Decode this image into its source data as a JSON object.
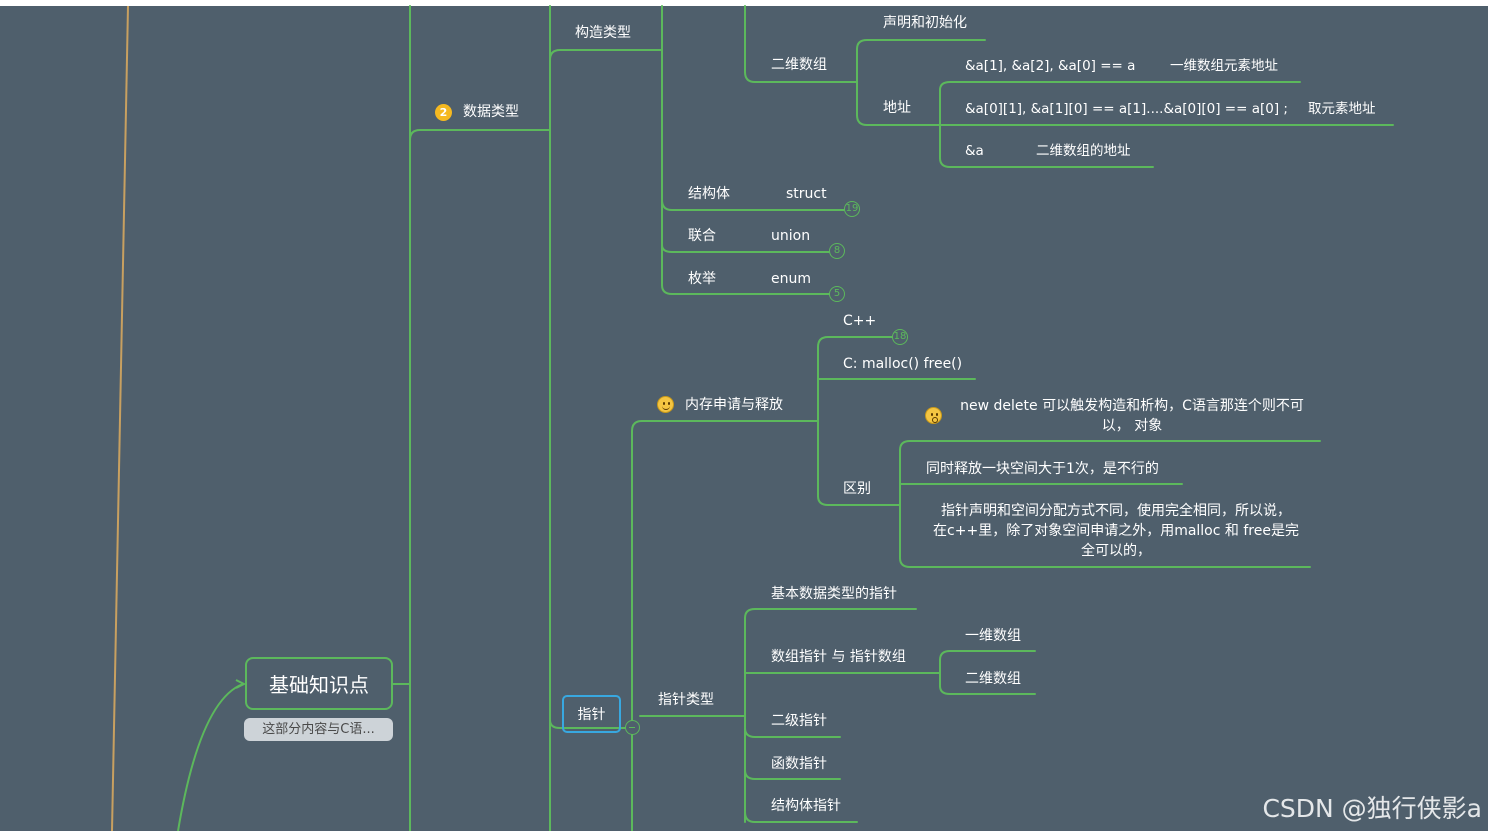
{
  "colors": {
    "background": "#4f5f6c",
    "branch": "#5cb85c",
    "root_connector": "#c8a060",
    "selection": "#38a8e0",
    "badge": "#f5b921"
  },
  "root": {
    "label": "基础知识点",
    "note": "这部分内容与C语..."
  },
  "data_types": {
    "number": "2",
    "label": "数据类型"
  },
  "construct": {
    "label": "构造类型"
  },
  "array2d": {
    "label": "二维数组",
    "decl": "声明和初始化",
    "addr": "地址"
  },
  "addr_rows": {
    "row1_a": "&a[1], &a[2], &a[0] == a",
    "row1_b": "一维数组元素地址",
    "row2_a": "&a[0][1], &a[1][0] == a[1]....&a[0][0] == a[0] ;",
    "row2_b": "取元素地址",
    "row3_a": "&a",
    "row3_b": "二维数组的地址"
  },
  "struct_row": {
    "label": "结构体",
    "kw": "struct",
    "count": "19"
  },
  "union_row": {
    "label": "联合",
    "kw": "union",
    "count": "8"
  },
  "enum_row": {
    "label": "枚举",
    "kw": "enum",
    "count": "5"
  },
  "memory": {
    "label": "内存申请与释放",
    "emoji": "smile-emoji",
    "cpp": "C++",
    "cpp_count": "18",
    "c": "C: malloc()   free()",
    "diff": "区别",
    "diff_emoji": "surprised-emoji",
    "diff_1a": "new delete 可以触发构造和析构，C语言那连个则不可",
    "diff_1b": "以， 对象",
    "diff_2": "同时释放一块空间大于1次，是不行的",
    "diff_3a": "指针声明和空间分配方式不同，使用完全相同，所以说，",
    "diff_3b": "在c++里，除了对象空间申请之外，用malloc 和 free是完",
    "diff_3c": "全可以的，"
  },
  "pointer": {
    "label": "指针"
  },
  "ptr_types": {
    "label": "指针类型",
    "basic": "基本数据类型的指针",
    "arr": "数组指针 与 指针数组",
    "arr_1d": "一维数组",
    "arr_2d": "二维数组",
    "level2": "二级指针",
    "func": "函数指针",
    "struct": "结构体指针"
  },
  "watermark": "CSDN @独行侠影a"
}
